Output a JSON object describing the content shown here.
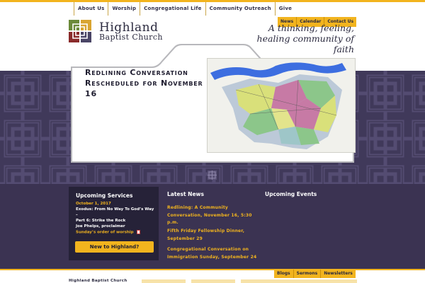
{
  "top_nav": {
    "items": [
      {
        "label": "About Us"
      },
      {
        "label": "Worship"
      },
      {
        "label": "Congregational Life"
      },
      {
        "label": "Community Outreach"
      },
      {
        "label": "Give"
      }
    ]
  },
  "header": {
    "brand_line1": "Highland",
    "brand_line2": "Baptist Church",
    "tagline": "A thinking, feeling, healing community of faith",
    "util_nav": [
      {
        "label": "News"
      },
      {
        "label": "Calendar"
      },
      {
        "label": "Contact Us"
      }
    ]
  },
  "feature": {
    "title": "Redlining Conversation Rescheduled for November 16"
  },
  "services": {
    "heading": "Upcoming Services",
    "date": "October 1, 2017",
    "line1": "Exodus: From No Way To God’s Way",
    "line2": "–",
    "line3": "Part 6: Strike the Rock",
    "line4": "Joe Phelps, proclaimer",
    "line5": "Sunday’s order of worship",
    "button_label": "New to Highland?"
  },
  "latest_news": {
    "heading": "Latest News",
    "items": [
      {
        "text": "Redlining: A Community Conversation, November 16, 5:30 p.m."
      },
      {
        "text": "Fifth Friday Fellowship Dinner, September 29"
      },
      {
        "text": "Congregational Conversation on Immigration Sunday, September 24"
      }
    ]
  },
  "upcoming_events": {
    "heading": "Upcoming Events"
  },
  "bottom_tabs": [
    {
      "label": "Blogs"
    },
    {
      "label": "Sermons"
    },
    {
      "label": "Newsletters"
    }
  ],
  "footer": {
    "name": "Highland Baptist Church"
  },
  "colors": {
    "gold": "#f2b41e",
    "purple_dark": "#3b3352",
    "purple_band": "#40395a",
    "navy_text": "#2b2a3f"
  }
}
